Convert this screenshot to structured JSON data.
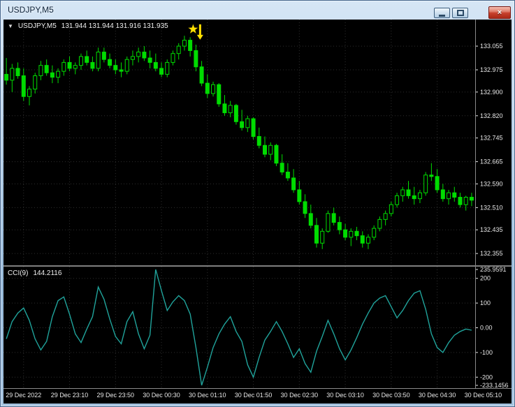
{
  "window": {
    "title": "USDJPY,M5",
    "close_glyph": "×"
  },
  "chart_header": {
    "dropdown_icon": "▼",
    "symbol": "USDJPY,M5",
    "ohlc": "131.944 131.944 131.916 131.935"
  },
  "indicator_header": {
    "name": "CCI(9)",
    "value": "144.2116"
  },
  "colors": {
    "background": "#000000",
    "candle": "#00DC00",
    "grid": "#2E2E2E",
    "axis_text": "#E8E8E8",
    "separator": "#8A8A8A",
    "indicator_line": "#20A39B",
    "marker": "#FFE100"
  },
  "chart_data": [
    {
      "type": "candlestick",
      "symbol": "USDJPY",
      "timeframe": "M5",
      "x_labels": [
        "29 Dec 2022",
        "29 Dec 23:10",
        "29 Dec 23:50",
        "30 Dec 00:30",
        "30 Dec 01:10",
        "30 Dec 01:50",
        "30 Dec 02:30",
        "30 Dec 03:10",
        "30 Dec 03:50",
        "30 Dec 04:30",
        "30 Dec 05:10"
      ],
      "ylim": [
        132.32,
        133.14
      ],
      "price_ticks": [
        {
          "label": "133.055",
          "value": 133.055
        },
        {
          "label": "132.975",
          "value": 132.975
        },
        {
          "label": "132.900",
          "value": 132.9
        },
        {
          "label": "132.820",
          "value": 132.82
        },
        {
          "label": "132.745",
          "value": 132.745
        },
        {
          "label": "132.665",
          "value": 132.665
        },
        {
          "label": "132.590",
          "value": 132.59
        },
        {
          "label": "132.510",
          "value": 132.51
        },
        {
          "label": "132.435",
          "value": 132.435
        },
        {
          "label": "132.355",
          "value": 132.355
        }
      ],
      "marker": {
        "description": "yellow star and down arrow above peak candles",
        "candle_index": 33,
        "price": 133.112,
        "color": "#FFE100"
      },
      "candles": [
        [
          132.96,
          133.015,
          132.925,
          132.94
        ],
        [
          132.94,
          132.995,
          132.9,
          132.98
        ],
        [
          132.98,
          133.0,
          132.945,
          132.955
        ],
        [
          132.955,
          132.98,
          132.87,
          132.885
        ],
        [
          132.885,
          132.92,
          132.855,
          132.91
        ],
        [
          132.91,
          132.965,
          132.895,
          132.955
        ],
        [
          132.955,
          133.005,
          132.94,
          132.99
        ],
        [
          132.99,
          133.01,
          132.955,
          132.965
        ],
        [
          132.965,
          132.99,
          132.93,
          132.95
        ],
        [
          132.95,
          132.98,
          132.93,
          132.97
        ],
        [
          132.97,
          133.01,
          132.955,
          133.0
        ],
        [
          133.0,
          133.02,
          132.97,
          132.98
        ],
        [
          132.98,
          133.0,
          132.96,
          132.99
        ],
        [
          132.99,
          133.03,
          132.975,
          133.02
        ],
        [
          133.02,
          133.04,
          132.99,
          133.0
        ],
        [
          133.0,
          133.02,
          132.97,
          132.98
        ],
        [
          132.98,
          133.05,
          132.97,
          133.035
        ],
        [
          133.035,
          133.05,
          133.0,
          133.01
        ],
        [
          133.01,
          133.03,
          132.98,
          132.99
        ],
        [
          132.99,
          133.01,
          132.96,
          132.975
        ],
        [
          132.975,
          133.0,
          132.95,
          132.97
        ],
        [
          132.97,
          133.02,
          132.96,
          133.01
        ],
        [
          133.01,
          133.04,
          132.99,
          133.02
        ],
        [
          133.02,
          133.05,
          133.0,
          133.035
        ],
        [
          133.035,
          133.055,
          133.005,
          133.015
        ],
        [
          133.015,
          133.04,
          132.98,
          133.0
        ],
        [
          133.0,
          133.03,
          132.97,
          132.98
        ],
        [
          132.98,
          133.0,
          132.95,
          132.96
        ],
        [
          132.96,
          133.01,
          132.95,
          133.0
        ],
        [
          133.0,
          133.04,
          132.99,
          133.03
        ],
        [
          133.03,
          133.065,
          133.01,
          133.055
        ],
        [
          133.055,
          133.09,
          133.04,
          133.075
        ],
        [
          133.075,
          133.085,
          133.02,
          133.04
        ],
        [
          133.04,
          133.06,
          132.97,
          132.985
        ],
        [
          132.985,
          133.005,
          132.92,
          132.93
        ],
        [
          132.93,
          132.96,
          132.88,
          132.895
        ],
        [
          132.895,
          132.935,
          132.885,
          132.925
        ],
        [
          132.925,
          132.93,
          132.85,
          132.86
        ],
        [
          132.86,
          132.89,
          132.82,
          132.83
        ],
        [
          132.83,
          132.87,
          132.815,
          132.855
        ],
        [
          132.855,
          132.86,
          132.79,
          132.8
        ],
        [
          132.8,
          132.84,
          132.77,
          132.78
        ],
        [
          132.78,
          132.82,
          132.765,
          132.81
        ],
        [
          132.81,
          132.815,
          132.74,
          132.75
        ],
        [
          132.75,
          132.78,
          132.71,
          132.72
        ],
        [
          132.72,
          132.75,
          132.68,
          132.69
        ],
        [
          132.69,
          132.73,
          132.67,
          132.72
        ],
        [
          132.72,
          132.725,
          132.65,
          132.66
        ],
        [
          132.66,
          132.69,
          132.62,
          132.63
        ],
        [
          132.63,
          132.66,
          132.6,
          132.61
        ],
        [
          132.61,
          132.64,
          132.56,
          132.57
        ],
        [
          132.57,
          132.6,
          132.52,
          132.53
        ],
        [
          132.53,
          132.555,
          132.475,
          132.49
        ],
        [
          132.49,
          132.52,
          132.44,
          132.45
        ],
        [
          132.45,
          132.475,
          132.375,
          132.39
        ],
        [
          132.39,
          132.44,
          132.37,
          132.43
        ],
        [
          132.43,
          132.5,
          132.425,
          132.49
        ],
        [
          132.49,
          132.51,
          132.45,
          132.46
        ],
        [
          132.46,
          132.48,
          132.42,
          132.435
        ],
        [
          132.435,
          132.455,
          132.4,
          132.41
        ],
        [
          132.41,
          132.44,
          132.38,
          132.43
        ],
        [
          132.43,
          132.445,
          132.4,
          132.415
        ],
        [
          132.415,
          132.43,
          132.375,
          132.39
        ],
        [
          132.39,
          132.42,
          132.37,
          132.41
        ],
        [
          132.41,
          132.45,
          132.4,
          132.44
        ],
        [
          132.44,
          132.48,
          132.43,
          132.47
        ],
        [
          132.47,
          132.5,
          132.45,
          132.49
        ],
        [
          132.49,
          132.53,
          132.48,
          132.52
        ],
        [
          132.52,
          132.56,
          132.51,
          132.55
        ],
        [
          132.55,
          132.58,
          132.53,
          132.57
        ],
        [
          132.57,
          132.6,
          132.54,
          132.55
        ],
        [
          132.55,
          132.58,
          132.52,
          132.54
        ],
        [
          132.54,
          132.57,
          132.525,
          132.56
        ],
        [
          132.56,
          132.63,
          132.55,
          132.62
        ],
        [
          132.62,
          132.66,
          132.6,
          132.615
        ],
        [
          132.615,
          132.64,
          132.56,
          132.57
        ],
        [
          132.57,
          132.59,
          132.53,
          132.54
        ],
        [
          132.54,
          132.57,
          132.52,
          132.56
        ],
        [
          132.56,
          132.58,
          132.53,
          132.545
        ],
        [
          132.545,
          132.56,
          132.51,
          132.52
        ],
        [
          132.52,
          132.55,
          132.5,
          132.545
        ],
        [
          132.545,
          132.56,
          132.515,
          132.535
        ]
      ]
    },
    {
      "type": "line",
      "name": "CCI(9)",
      "current_value": "144.2116",
      "ylim": [
        -233.1456,
        235.9591
      ],
      "axis_ticks": [
        {
          "label": "235.9591",
          "value": 235.9591
        },
        {
          "label": "200",
          "value": 200
        },
        {
          "label": "100",
          "value": 100
        },
        {
          "label": "0.00",
          "value": 0
        },
        {
          "label": "-100",
          "value": -100
        },
        {
          "label": "-200",
          "value": -200
        },
        {
          "label": "-233.1456",
          "value": -233.1456
        }
      ],
      "grid_levels": [
        200,
        100,
        0,
        -100,
        -200
      ],
      "values": [
        -45,
        25,
        60,
        80,
        30,
        -45,
        -90,
        -55,
        45,
        110,
        125,
        55,
        -25,
        -60,
        -5,
        45,
        165,
        115,
        35,
        -35,
        -65,
        25,
        65,
        -25,
        -85,
        -30,
        236,
        150,
        70,
        105,
        130,
        110,
        55,
        -80,
        -233,
        -160,
        -80,
        -25,
        15,
        45,
        -15,
        -55,
        -150,
        -200,
        -120,
        -50,
        -15,
        25,
        -15,
        -65,
        -120,
        -85,
        -145,
        -180,
        -95,
        -35,
        30,
        -25,
        -85,
        -130,
        -90,
        -40,
        15,
        60,
        100,
        120,
        130,
        85,
        40,
        70,
        110,
        140,
        150,
        75,
        -25,
        -80,
        -100,
        -60,
        -30,
        -15,
        -5,
        -10
      ]
    }
  ]
}
